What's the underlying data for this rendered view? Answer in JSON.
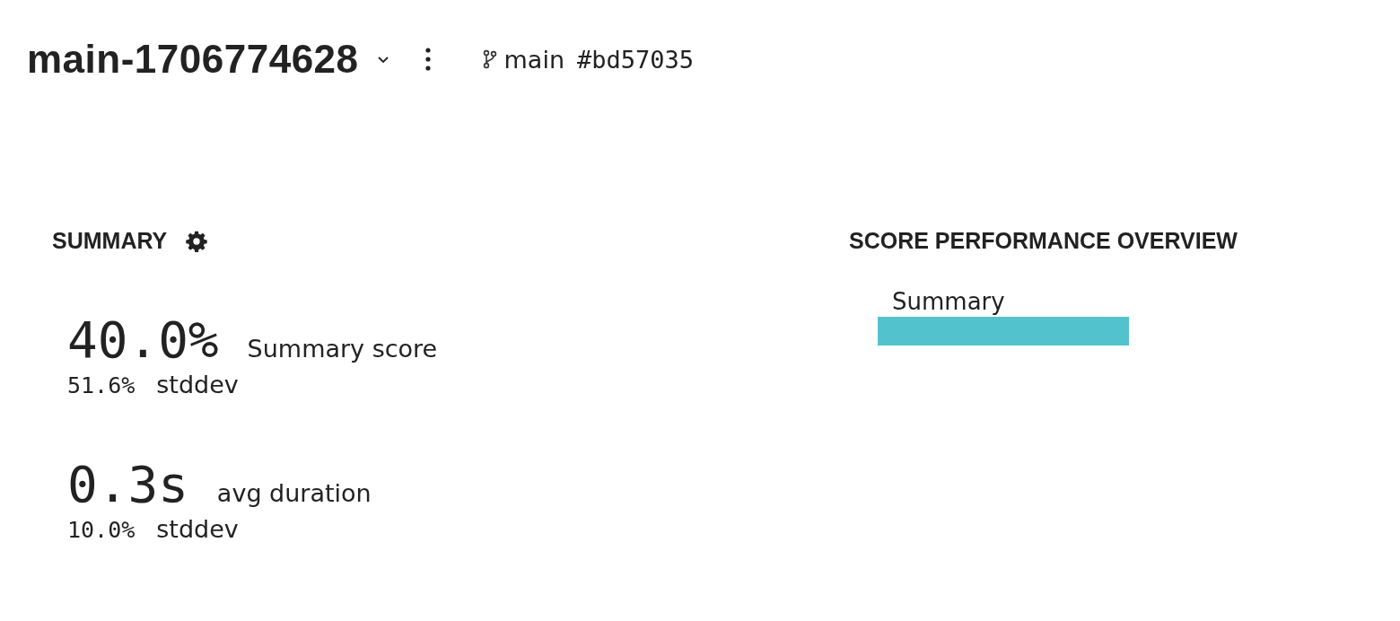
{
  "header": {
    "title": "main-1706774628",
    "branch": "main",
    "commit": "#bd57035"
  },
  "summary": {
    "title": "SUMMARY",
    "metrics": [
      {
        "value": "40.0%",
        "label": "Summary score",
        "spread": "51.6%",
        "spread_label": "stddev"
      },
      {
        "value": "0.3s",
        "label": "avg duration",
        "spread": "10.0%",
        "spread_label": "stddev"
      }
    ]
  },
  "overview": {
    "title": "SCORE PERFORMANCE OVERVIEW",
    "bar_label": "Summary"
  }
}
